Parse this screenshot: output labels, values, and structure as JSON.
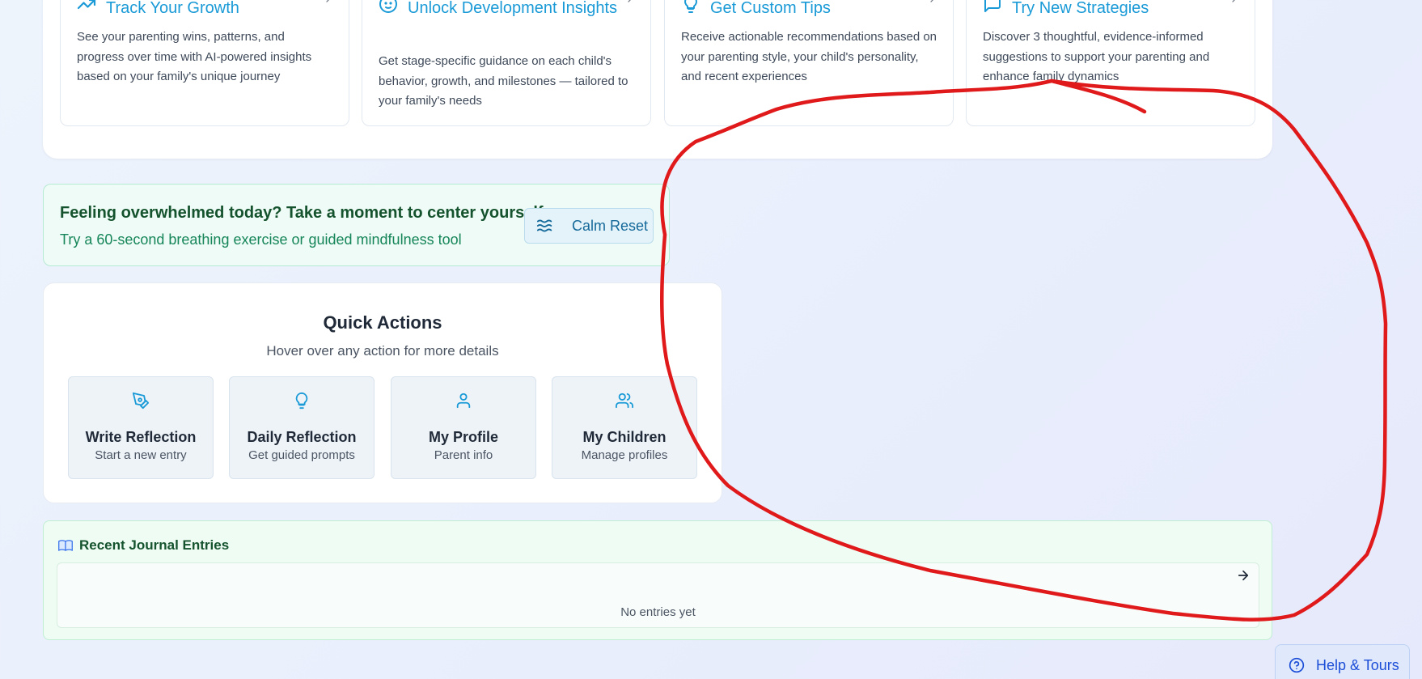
{
  "features": [
    {
      "title": "Track Your Growth",
      "icon": "trending-up-icon",
      "desc": "See your parenting wins, patterns, and progress over time with AI-powered insights based on your family's unique journey"
    },
    {
      "title": "Unlock Development Insights",
      "icon": "baby-face-icon",
      "desc": "Get stage-specific guidance on each child's behavior, growth, and milestones — tailored to your family's needs"
    },
    {
      "title": "Get Custom Tips",
      "icon": "lightbulb-icon",
      "desc": "Receive actionable recommendations based on your parenting style, your child's personality, and recent experiences"
    },
    {
      "title": "Try New Strategies",
      "icon": "message-square-icon",
      "desc": "Discover 3 thoughtful, evidence-informed suggestions to support your parenting and enhance family dynamics"
    }
  ],
  "calm": {
    "title": "Feeling overwhelmed today? Take a moment to center yourself.",
    "subtitle": "Try a 60-second breathing exercise or guided mindfulness tool",
    "button_label": "Calm Reset",
    "button_icon": "waves-icon"
  },
  "quick_actions": {
    "title": "Quick Actions",
    "subtitle": "Hover over any action for more details",
    "items": [
      {
        "label": "Write Reflection",
        "sub": "Start a new entry",
        "icon": "pen-tool-icon"
      },
      {
        "label": "Daily Reflection",
        "sub": "Get guided prompts",
        "icon": "lightbulb-icon"
      },
      {
        "label": "My Profile",
        "sub": "Parent info",
        "icon": "user-icon"
      },
      {
        "label": "My Children",
        "sub": "Manage profiles",
        "icon": "users-icon"
      }
    ]
  },
  "journal": {
    "title": "Recent Journal Entries",
    "title_icon": "book-icon",
    "empty_text": "No entries yet"
  },
  "help": {
    "label": "Help & Tours",
    "icon": "help-circle-icon"
  },
  "colors": {
    "accent": "#1a9ad6",
    "calm_green": "#16865a",
    "annotation_red": "#e0191b",
    "help_blue": "#1d4ed8"
  }
}
